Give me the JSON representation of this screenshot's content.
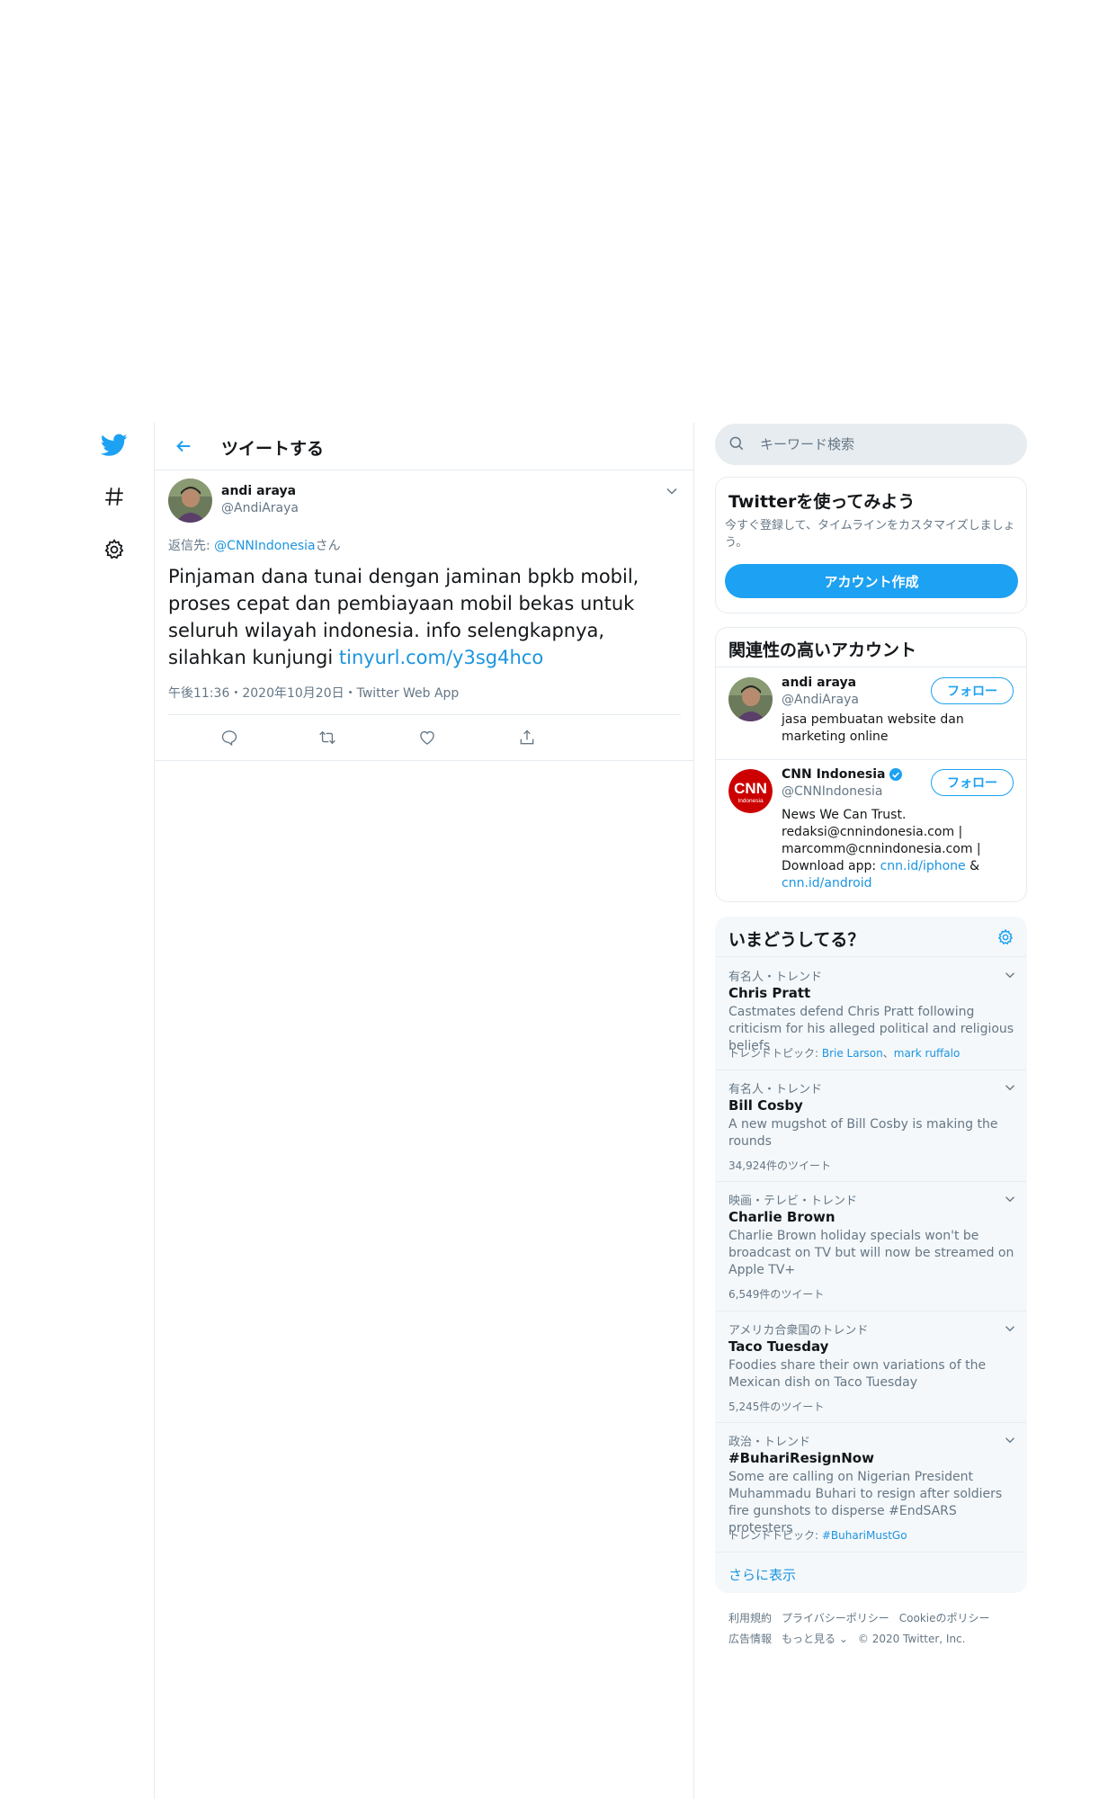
{
  "nav": {
    "icons": [
      "twitter-logo-icon",
      "hashtag-icon",
      "gear-icon"
    ]
  },
  "header": {
    "title": "ツイートする"
  },
  "tweet": {
    "name": "andi araya",
    "handle": "@AndiAraya",
    "reply_prefix": "返信先: ",
    "reply_handle": "@CNNIndonesia",
    "reply_suffix": "さん",
    "text": "Pinjaman dana tunai dengan jaminan bpkb mobil, proses cepat dan pembiayaan mobil bekas untuk seluruh wilayah indonesia. info selengkapnya, silahkan kunjungi ",
    "link": "tinyurl.com/y3sg4hco",
    "meta": "午後11:36・2020年10月20日・Twitter Web App"
  },
  "search": {
    "placeholder": "キーワード検索"
  },
  "signup": {
    "title": "Twitterを使ってみよう",
    "desc": "今すぐ登録して、タイムラインをカスタマイズしましょう。",
    "button": "アカウント作成"
  },
  "related": {
    "title": "関連性の高いアカウント",
    "follow_label": "フォロー",
    "accounts": [
      {
        "name": "andi araya",
        "handle": "@AndiAraya",
        "bio": "jasa pembuatan website dan marketing online"
      },
      {
        "name": "CNN Indonesia",
        "handle": "@CNNIndonesia",
        "bio_text": "News We Can Trust. redaksi@cnnindonesia.com | marcomm@cnnindonesia.com | Download app: ",
        "bio_link1": "cnn.id/iphone",
        "bio_amp": " & ",
        "bio_link2": "cnn.id/android"
      }
    ]
  },
  "trends": {
    "title": "いまどうしてる？",
    "items": [
      {
        "meta": "有名人・トレンド",
        "name": "Chris Pratt",
        "desc": "Castmates defend Chris Pratt following criticism for his alleged political and religious beliefs",
        "extra_label": "トレンドトピック: ",
        "extra_link1": "Brie Larson",
        "extra_sep": "、",
        "extra_link2": "mark ruffalo"
      },
      {
        "meta": "有名人・トレンド",
        "name": "Bill Cosby",
        "desc": "A new mugshot of Bill Cosby is making the rounds",
        "count": "34,924件のツイート"
      },
      {
        "meta": "映画・テレビ・トレンド",
        "name": "Charlie Brown",
        "desc": "Charlie Brown holiday specials won't be broadcast on TV but will now be streamed on Apple TV+",
        "count": "6,549件のツイート"
      },
      {
        "meta": "アメリカ合衆国のトレンド",
        "name": "Taco Tuesday",
        "desc": "Foodies share their own variations of the Mexican dish on Taco Tuesday",
        "count": "5,245件のツイート"
      },
      {
        "meta": "政治・トレンド",
        "name": "#BuhariResignNow",
        "desc": "Some are calling on Nigerian President Muhammadu Buhari to resign after soldiers fire gunshots to disperse #EndSARS protesters",
        "extra_label": "トレンドトピック: ",
        "extra_link1": "#BuhariMustGo"
      }
    ],
    "more": "さらに表示"
  },
  "footer": {
    "links_row1": [
      "利用規約",
      "プライバシーポリシー",
      "Cookieのポリシー"
    ],
    "links_row2": [
      "広告情報",
      "もっと見る ⌄",
      "© 2020 Twitter, Inc."
    ]
  },
  "colors": {
    "accent": "#1da1f2",
    "link": "#1b95e0",
    "muted": "#657786",
    "border": "#e6ecf0"
  }
}
